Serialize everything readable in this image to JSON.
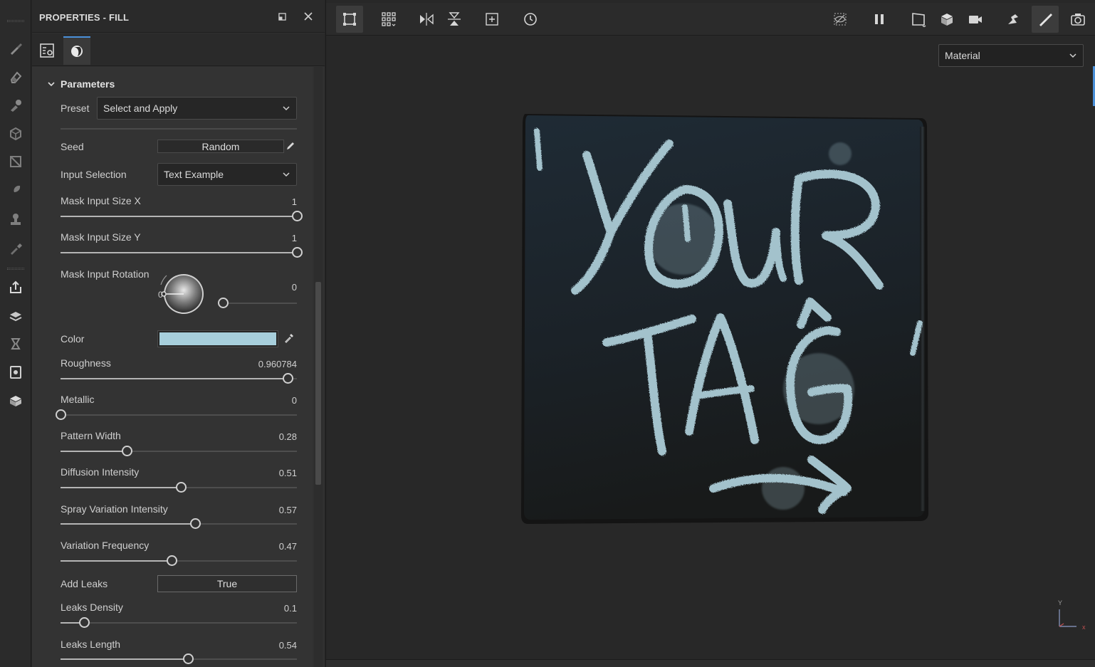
{
  "panel": {
    "title": "PROPERTIES - FILL",
    "section_title": "Parameters",
    "preset": {
      "label": "Preset",
      "value": "Select and Apply"
    },
    "seed": {
      "label": "Seed",
      "value": "Random"
    },
    "input_selection": {
      "label": "Input Selection",
      "value": "Text Example"
    },
    "mask_size_x": {
      "label": "Mask Input Size X",
      "value": "1",
      "fraction": 1.0
    },
    "mask_size_y": {
      "label": "Mask Input Size Y",
      "value": "1",
      "fraction": 1.0
    },
    "mask_rotation": {
      "label": "Mask Input Rotation",
      "value": "0",
      "dial_zero": "0",
      "fraction": 0.0
    },
    "color": {
      "label": "Color",
      "swatch": "#a7cfdc"
    },
    "roughness": {
      "label": "Roughness",
      "value": "0.960784",
      "fraction": 0.96
    },
    "metallic": {
      "label": "Metallic",
      "value": "0",
      "fraction": 0.0
    },
    "pattern_width": {
      "label": "Pattern Width",
      "value": "0.28",
      "fraction": 0.28
    },
    "diffusion_intensity": {
      "label": "Diffusion Intensity",
      "value": "0.51",
      "fraction": 0.51
    },
    "spray_variation": {
      "label": "Spray Variation Intensity",
      "value": "0.57",
      "fraction": 0.57
    },
    "variation_frequency": {
      "label": "Variation Frequency",
      "value": "0.47",
      "fraction": 0.47
    },
    "add_leaks": {
      "label": "Add Leaks",
      "value": "True"
    },
    "leaks_density": {
      "label": "Leaks Density",
      "value": "0.1",
      "fraction": 0.1
    },
    "leaks_length": {
      "label": "Leaks Length",
      "value": "0.54",
      "fraction": 0.54
    }
  },
  "viewport": {
    "view_mode": "Material",
    "axis_x": "x",
    "axis_y": "Y"
  },
  "colors": {
    "accent": "#4a90d9",
    "paint": "#a3c2cc",
    "tile": "#1e2730"
  },
  "icons": {
    "left_toolbar": [
      "brush-icon",
      "eraser-icon",
      "projection-icon",
      "geometry-fill-icon",
      "polygon-fill-icon",
      "smudge-icon",
      "clone-stamp-icon",
      "color-picker-icon",
      "export-icon",
      "bake-icon",
      "history-icon",
      "texture-set-icon",
      "display-settings-icon"
    ],
    "viewport_toolbar": [
      "selection-mode-icon",
      "grid-icon",
      "mirror-x-icon",
      "mirror-y-icon",
      "fit-icon",
      "reset-camera-icon",
      "hide-icon",
      "pause-icon",
      "viewport-2d-icon",
      "viewport-3d-icon",
      "camera-icon",
      "split-icon",
      "paint-mode-icon",
      "screenshot-icon"
    ]
  }
}
